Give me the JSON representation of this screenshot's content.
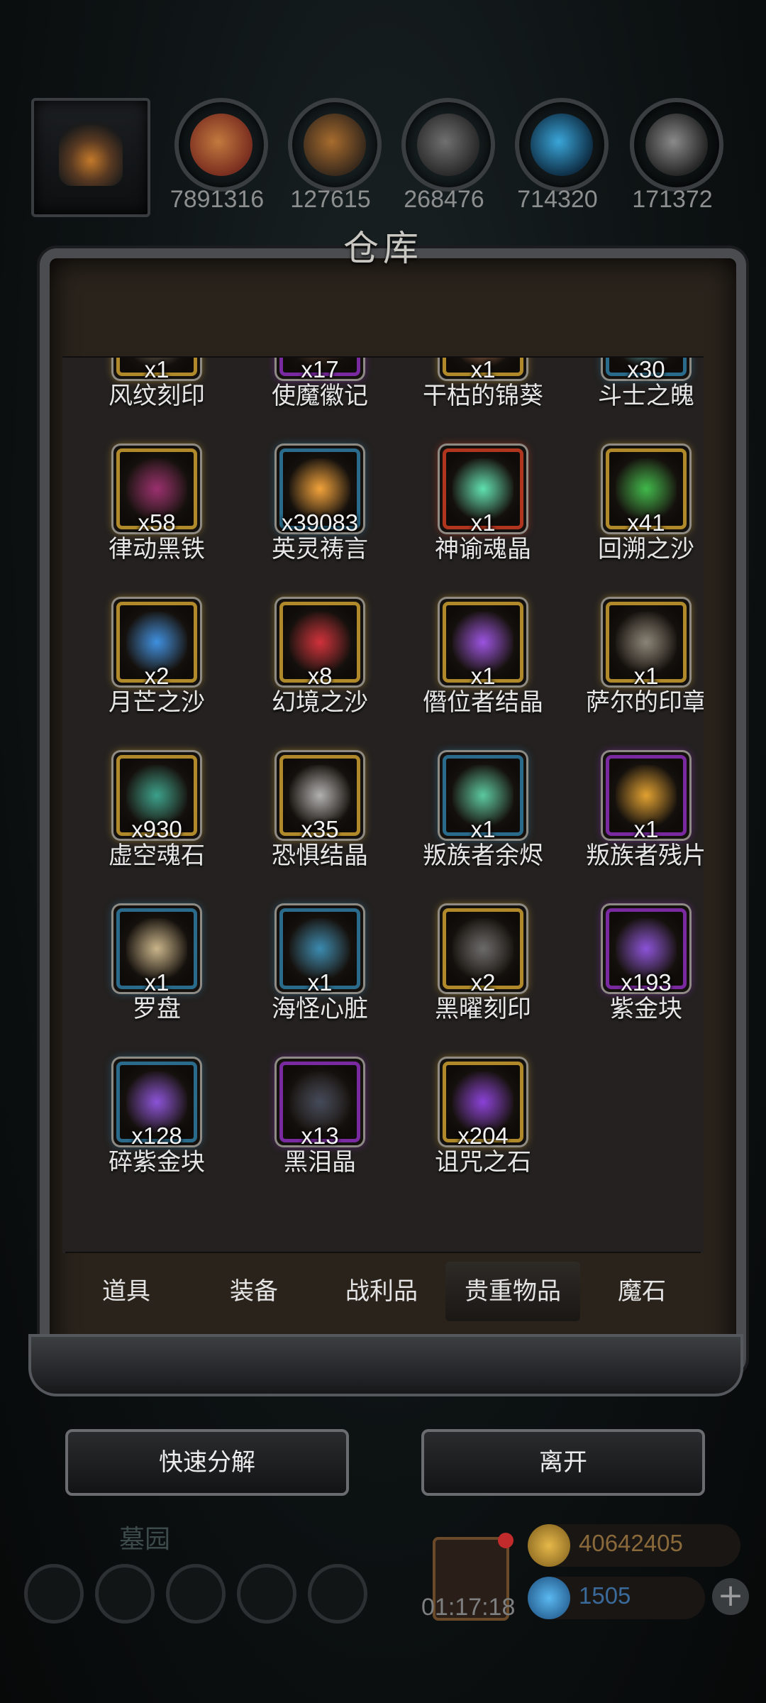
{
  "resources": [
    {
      "icon": "meat-icon",
      "count": "7891316",
      "color": "#7a2e20",
      "accent": "#c27a3e"
    },
    {
      "icon": "wood-icon",
      "count": "127615",
      "color": "#3a2a1c",
      "accent": "#a86c2e"
    },
    {
      "icon": "stone-icon",
      "count": "268476",
      "color": "#2a2a2a",
      "accent": "#707070"
    },
    {
      "icon": "crystal-icon",
      "count": "714320",
      "color": "#0f3048",
      "accent": "#3aa6d9"
    },
    {
      "icon": "iron-icon",
      "count": "171372",
      "color": "#262626",
      "accent": "#8a8a8a"
    }
  ],
  "panel": {
    "title": "仓库"
  },
  "items": [
    {
      "name": "风纹刻印",
      "qty": "x1",
      "frame": "gold",
      "art": "#8a8275"
    },
    {
      "name": "使魔徽记",
      "qty": "x17",
      "frame": "purple",
      "art": "#6b4a3a"
    },
    {
      "name": "干枯的锦葵",
      "qty": "x1",
      "frame": "gold",
      "art": "#d98f6a"
    },
    {
      "name": "斗士之魄",
      "qty": "x30",
      "frame": "blue",
      "art": "#6fe3f0"
    },
    {
      "name": "律动黑铁",
      "qty": "x58",
      "frame": "gold",
      "art": "#9a2f6e"
    },
    {
      "name": "英灵祷言",
      "qty": "x39083",
      "frame": "blue",
      "art": "#f2a23a"
    },
    {
      "name": "神谕魂晶",
      "qty": "x1",
      "frame": "red",
      "art": "#5fe0b0"
    },
    {
      "name": "回溯之沙",
      "qty": "x41",
      "frame": "gold",
      "art": "#3fb84a"
    },
    {
      "name": "月芒之沙",
      "qty": "x2",
      "frame": "gold",
      "art": "#3d8fe0"
    },
    {
      "name": "幻境之沙",
      "qty": "x8",
      "frame": "gold",
      "art": "#d0303a"
    },
    {
      "name": "僭位者结晶",
      "qty": "x1",
      "frame": "gold",
      "art": "#9a52e0"
    },
    {
      "name": "萨尔的印章",
      "qty": "x1",
      "frame": "gold",
      "art": "#8a8478"
    },
    {
      "name": "虚空魂石",
      "qty": "x930",
      "frame": "gold",
      "art": "#3aa08a"
    },
    {
      "name": "恐惧结晶",
      "qty": "x35",
      "frame": "gold",
      "art": "#b0b0b0"
    },
    {
      "name": "叛族者余烬",
      "qty": "x1",
      "frame": "blue",
      "art": "#5ac8a0"
    },
    {
      "name": "叛族者残片",
      "qty": "x1",
      "frame": "purple",
      "art": "#e0a030"
    },
    {
      "name": "罗盘",
      "qty": "x1",
      "frame": "blue",
      "art": "#c8b48a"
    },
    {
      "name": "海怪心脏",
      "qty": "x1",
      "frame": "blue",
      "art": "#3a8ab0"
    },
    {
      "name": "黑曜刻印",
      "qty": "x2",
      "frame": "gold",
      "art": "#6a6a6a"
    },
    {
      "name": "紫金块",
      "qty": "x193",
      "frame": "purple",
      "art": "#8a52d8"
    },
    {
      "name": "碎紫金块",
      "qty": "x128",
      "frame": "blue",
      "art": "#8a52d8"
    },
    {
      "name": "黑泪晶",
      "qty": "x13",
      "frame": "purple",
      "art": "#444a5a"
    },
    {
      "name": "诅咒之石",
      "qty": "x204",
      "frame": "gold",
      "art": "#8a40d8"
    }
  ],
  "tabs": [
    {
      "label": "道具"
    },
    {
      "label": "装备"
    },
    {
      "label": "战利品"
    },
    {
      "label": "贵重物品",
      "active": true
    },
    {
      "label": "魔石"
    }
  ],
  "buttons": {
    "decompose": "快速分解",
    "leave": "离开"
  },
  "hud": {
    "location": "墓园",
    "timer": "01:17:18",
    "gold": "40642405",
    "gems": "1505",
    "plus": "+"
  },
  "colors": {
    "gold": "#b08a2a",
    "purple": "#7a2aa0",
    "blue": "#2a6a8a",
    "red": "#b0351e"
  }
}
